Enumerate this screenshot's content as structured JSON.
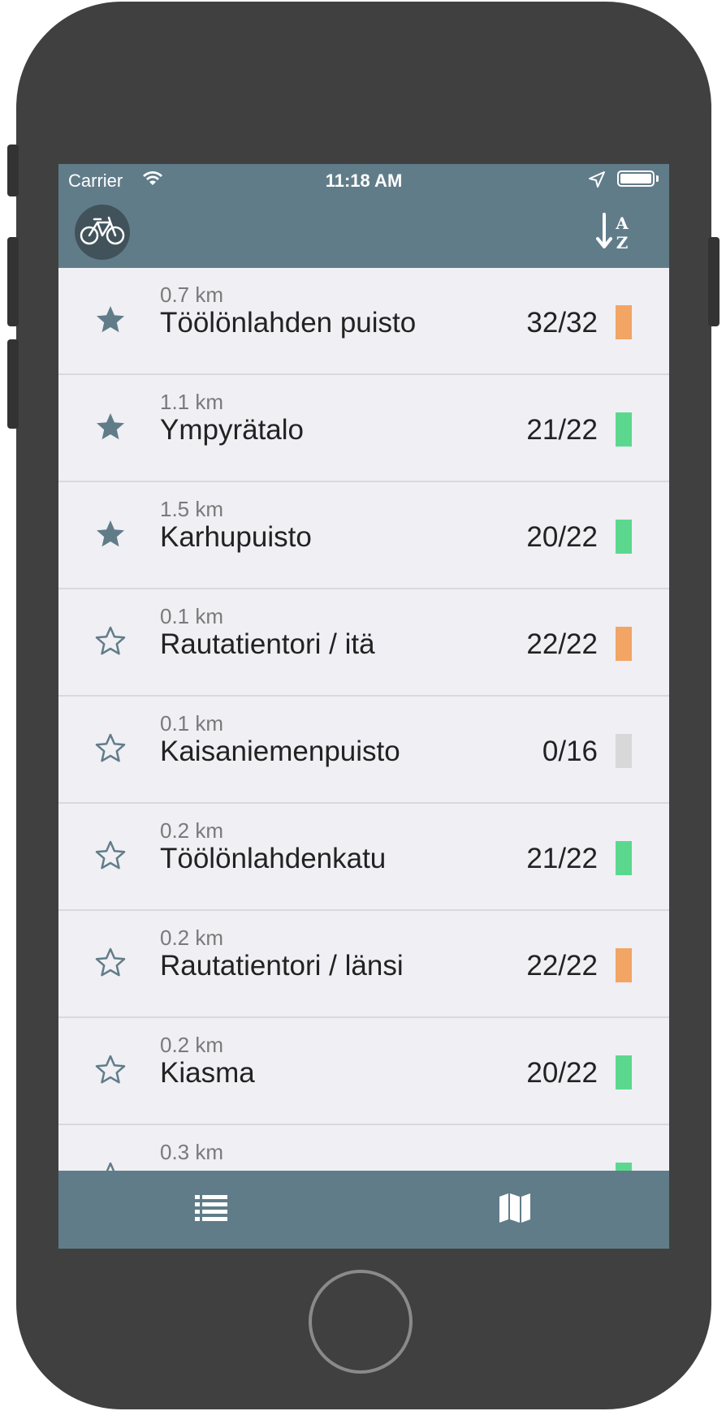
{
  "status_bar": {
    "carrier": "Carrier",
    "time": "11:18 AM"
  },
  "nav_bar": {
    "bike_icon": "bicycle-icon",
    "sort_icon": "sort-alpha-icon",
    "sort_top_letter": "A",
    "sort_bottom_letter": "Z"
  },
  "stations": [
    {
      "distance": "0.7 km",
      "name": "Töölönlahden puisto",
      "count": "32/32",
      "favorite": true,
      "status_color": "#f2a564"
    },
    {
      "distance": "1.1 km",
      "name": "Ympyrätalo",
      "count": "21/22",
      "favorite": true,
      "status_color": "#5cd88e"
    },
    {
      "distance": "1.5 km",
      "name": "Karhupuisto",
      "count": "20/22",
      "favorite": true,
      "status_color": "#5cd88e"
    },
    {
      "distance": "0.1 km",
      "name": "Rautatientori / itä",
      "count": "22/22",
      "favorite": false,
      "status_color": "#f2a564"
    },
    {
      "distance": "0.1 km",
      "name": "Kaisaniemenpuisto",
      "count": "0/16",
      "favorite": false,
      "status_color": "#d8d8d8"
    },
    {
      "distance": "0.2 km",
      "name": "Töölönlahdenkatu",
      "count": "21/22",
      "favorite": false,
      "status_color": "#5cd88e"
    },
    {
      "distance": "0.2 km",
      "name": "Rautatientori / länsi",
      "count": "22/22",
      "favorite": false,
      "status_color": "#f2a564"
    },
    {
      "distance": "0.2 km",
      "name": "Kiasma",
      "count": "20/22",
      "favorite": false,
      "status_color": "#5cd88e"
    },
    {
      "distance": "0.3 km",
      "name": "",
      "count": "",
      "favorite": false,
      "status_color": "#5cd88e"
    }
  ],
  "tab_bar": {
    "list_icon": "list-icon",
    "map_icon": "map-icon"
  },
  "colors": {
    "bar_bg": "#617c89",
    "list_bg": "#efeff4",
    "star": "#617c89"
  }
}
